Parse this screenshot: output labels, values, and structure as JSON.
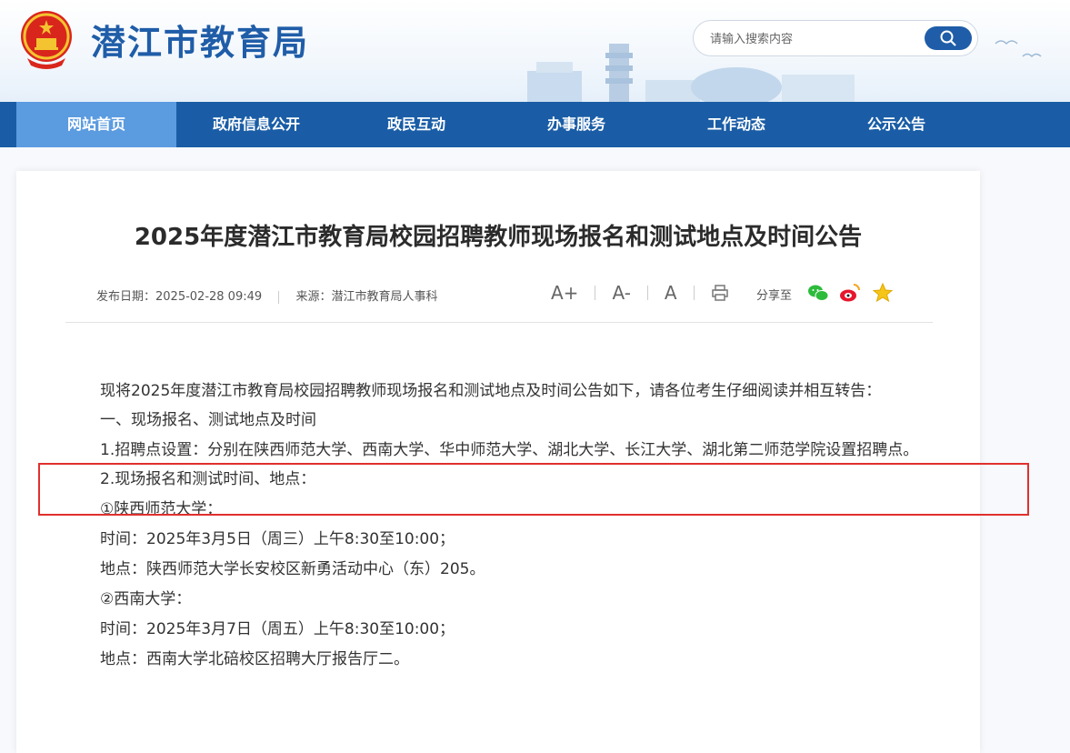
{
  "header": {
    "site_title": "潜江市教育局",
    "search_placeholder": "请输入搜索内容"
  },
  "nav": {
    "items": [
      "网站首页",
      "政府信息公开",
      "政民互动",
      "办事服务",
      "工作动态",
      "公示公告"
    ],
    "active_index": 0
  },
  "article": {
    "title": "2025年度潜江市教育局校园招聘教师现场报名和测试地点及时间公告",
    "meta": {
      "publish_date": "发布日期：2025-02-28 09:49",
      "source": "来源：潜江市教育局人事科"
    },
    "tools": {
      "font_larger": "A+",
      "font_smaller": "A-",
      "font_default": "A",
      "print_icon": "printer-icon"
    },
    "share_label": "分享至",
    "share_icons": [
      "wechat-icon",
      "weibo-icon",
      "favorite-star-icon"
    ],
    "paragraphs": {
      "intro": "现将2025年度潜江市教育局校园招聘教师现场报名和测试地点及时间公告如下，请各位考生仔细阅读并相互转告：",
      "section1": "一、现场报名、测试地点及时间",
      "item1": "1.招聘点设置：分别在陕西师范大学、西南大学、华中师范大学、湖北大学、长江大学、湖北第二师范学院设置招聘点。",
      "item2": "2.现场报名和测试时间、地点：",
      "school1": "①陕西师范大学：",
      "time1": "时间：2025年3月5日（周三）上午8:30至10:00；",
      "place1": "地点：陕西师范大学长安校区新勇活动中心（东）205。",
      "school2": "②西南大学：",
      "time2": "时间：2025年3月7日（周五）上午8:30至10:00；",
      "place2": "地点：西南大学北碚校区招聘大厅报告厅二。"
    }
  },
  "colors": {
    "brand_blue": "#1a5da6",
    "nav_active": "#5b9be0",
    "highlight_red": "#e0302d"
  }
}
